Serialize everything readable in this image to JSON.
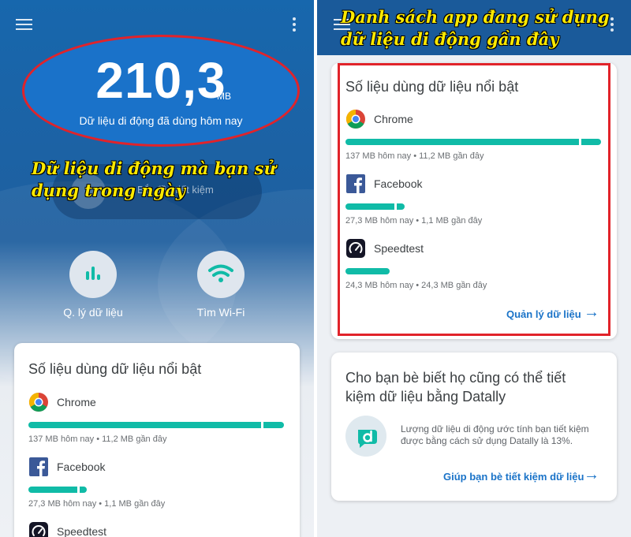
{
  "left": {
    "usage": {
      "amount": "210,3",
      "unit": "MB",
      "subtitle": "Dữ liệu di động đã dùng hôm nay"
    },
    "saver_pill": {
      "label": "Bắt đầu tiết kiệm"
    },
    "caption": "Dữ liệu di động mà bạn sử dụng trong ngày",
    "actions": [
      {
        "label": "Q. lý dữ liệu",
        "icon": "bar-chart-icon"
      },
      {
        "label": "Tìm Wi-Fi",
        "icon": "wifi-icon"
      }
    ],
    "card": {
      "title": "Số liệu dùng dữ liệu nổi bật",
      "apps": [
        {
          "name": "Chrome",
          "stats": "137 MB hôm nay • 11,2 MB gần đây",
          "bar_fraction": 1.0
        },
        {
          "name": "Facebook",
          "stats": "27,3 MB hôm nay • 1,1 MB gần đây",
          "bar_fraction": 0.22
        },
        {
          "name": "Speedtest",
          "stats": "",
          "bar_fraction": 0.17
        }
      ]
    }
  },
  "right": {
    "caption": "Danh sách app đang sử dụng dữ liệu di động gần đây",
    "card": {
      "title": "Số liệu dùng dữ liệu nổi bật",
      "apps": [
        {
          "name": "Chrome",
          "stats": "137 MB hôm nay • 11,2 MB gần đây",
          "bar_fraction": 1.0
        },
        {
          "name": "Facebook",
          "stats": "27,3 MB hôm nay • 1,1 MB gần đây",
          "bar_fraction": 0.23
        },
        {
          "name": "Speedtest",
          "stats": "24,3 MB hôm nay • 24,3 MB gần đây",
          "bar_fraction": 0.17
        }
      ],
      "link": "Quản lý dữ liệu"
    },
    "share_card": {
      "title": "Cho bạn bè biết họ cũng có thể tiết kiệm dữ liệu bằng Datally",
      "body": "Lượng dữ liệu di động ước tính bạn tiết kiệm được bằng cách sử dụng Datally là 13%.",
      "link": "Giúp bạn bè tiết kiệm dữ liệu"
    }
  },
  "colors": {
    "header_blue": "#1767ad",
    "accent_teal": "#10bba7",
    "link_blue": "#1a73c8",
    "highlight_red": "#e1232a",
    "caption_yellow": "#ffea00"
  }
}
